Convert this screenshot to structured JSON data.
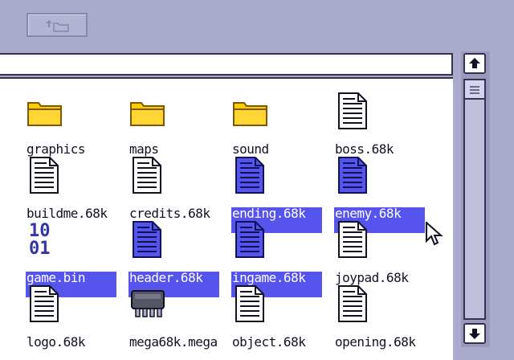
{
  "toolbar": {
    "up_button_icon": "up-folder-icon"
  },
  "colors": {
    "window_bg": "#aaaacc",
    "pane_bg": "#ffffff",
    "selection": "#5555ee"
  },
  "items": [
    {
      "label": "graphics",
      "icon": "folder-icon",
      "selected": false
    },
    {
      "label": "maps",
      "icon": "folder-icon",
      "selected": false
    },
    {
      "label": "sound",
      "icon": "folder-icon",
      "selected": false
    },
    {
      "label": "boss.68k",
      "icon": "document-icon",
      "selected": false
    },
    {
      "label": "buildme.68k",
      "icon": "document-icon",
      "selected": false
    },
    {
      "label": "credits.68k",
      "icon": "document-icon",
      "selected": false
    },
    {
      "label": "ending.68k",
      "icon": "document-icon",
      "selected": true
    },
    {
      "label": "enemy.68k",
      "icon": "document-icon",
      "selected": true
    },
    {
      "label": "game.bin",
      "icon": "binary-icon",
      "selected": true
    },
    {
      "label": "header.68k",
      "icon": "document-icon",
      "selected": true
    },
    {
      "label": "ingame.68k",
      "icon": "document-icon",
      "selected": true
    },
    {
      "label": "joypad.68k",
      "icon": "document-icon",
      "selected": false
    },
    {
      "label": "logo.68k",
      "icon": "document-icon",
      "selected": false
    },
    {
      "label": "mega68k.mega",
      "icon": "chip-icon",
      "selected": false
    },
    {
      "label": "object.68k",
      "icon": "document-icon",
      "selected": false
    },
    {
      "label": "opening.68k",
      "icon": "document-icon",
      "selected": false
    }
  ]
}
